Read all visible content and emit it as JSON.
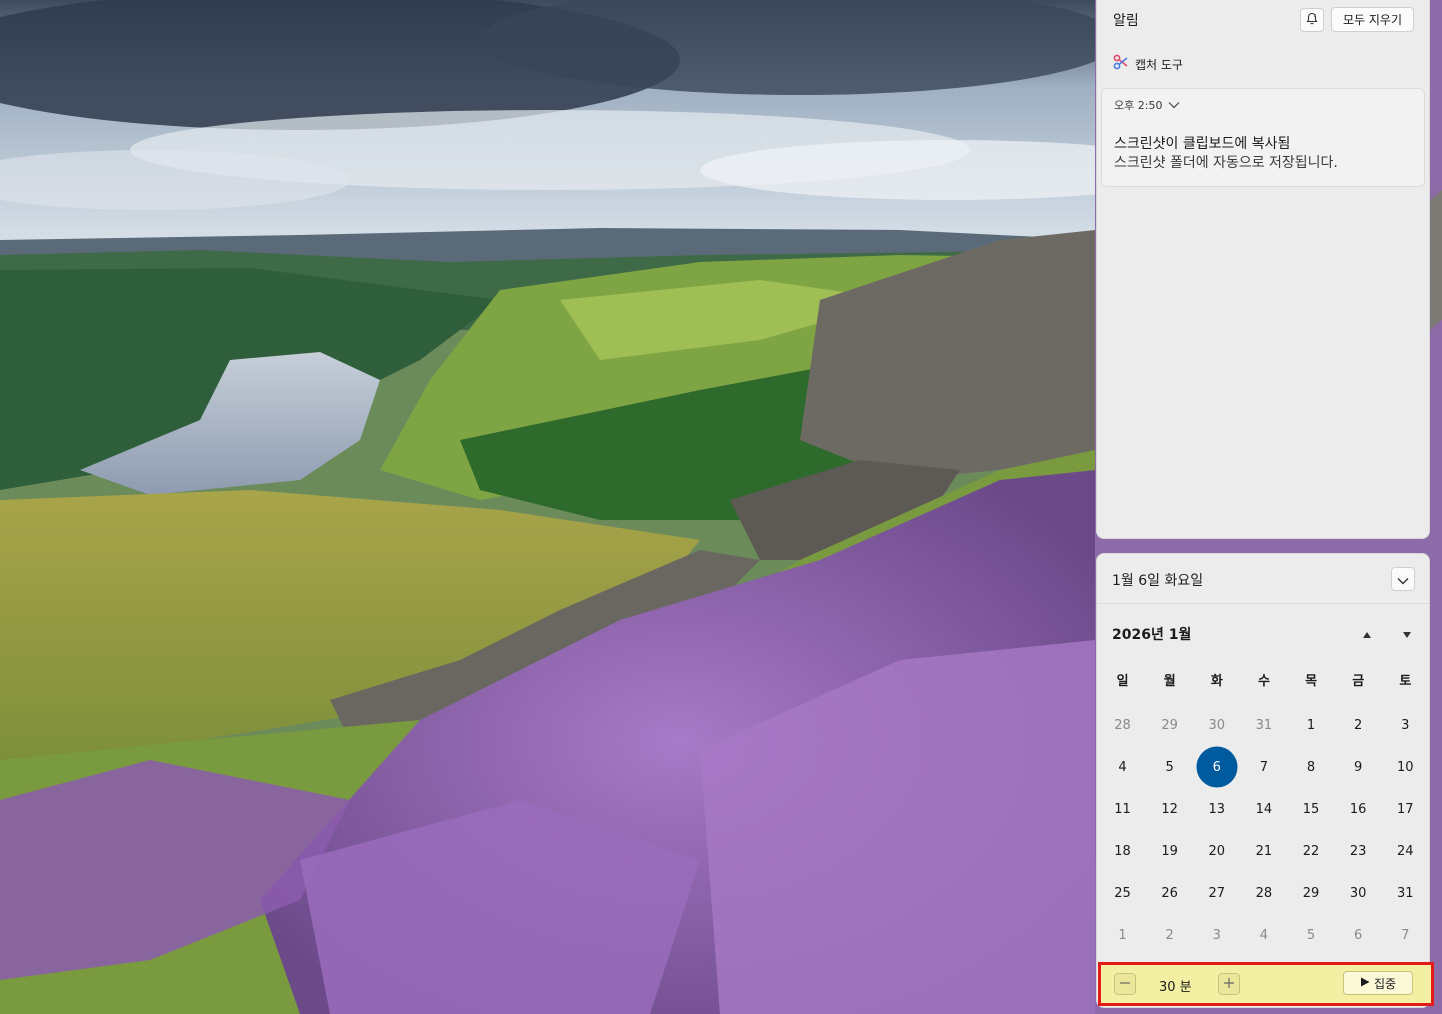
{
  "notifications": {
    "header": "알림",
    "clear_all_label": "모두 지우기",
    "app_name": "캡처 도구",
    "toast": {
      "time": "오후 2:50",
      "title": "스크린샷이 클립보드에 복사됨",
      "body": "스크린샷 폴더에 자동으로 저장됩니다."
    }
  },
  "calendar": {
    "date_title": "1월 6일 화요일",
    "month_title": "2026년 1월",
    "weekdays": [
      "일",
      "월",
      "화",
      "수",
      "목",
      "금",
      "토"
    ],
    "weeks": [
      [
        "28",
        "29",
        "30",
        "31",
        "1",
        "2",
        "3"
      ],
      [
        "4",
        "5",
        "6",
        "7",
        "8",
        "9",
        "10"
      ],
      [
        "11",
        "12",
        "13",
        "14",
        "15",
        "16",
        "17"
      ],
      [
        "18",
        "19",
        "20",
        "21",
        "22",
        "23",
        "24"
      ],
      [
        "25",
        "26",
        "27",
        "28",
        "29",
        "30",
        "31"
      ],
      [
        "1",
        "2",
        "3",
        "4",
        "5",
        "6",
        "7"
      ]
    ],
    "today": "6"
  },
  "focus": {
    "duration": "30 분",
    "start_label": "집중"
  },
  "colors": {
    "accent": "#005a9e",
    "highlight_border": "#e41b1b",
    "focus_bar_bg": "#f4f0a3"
  }
}
